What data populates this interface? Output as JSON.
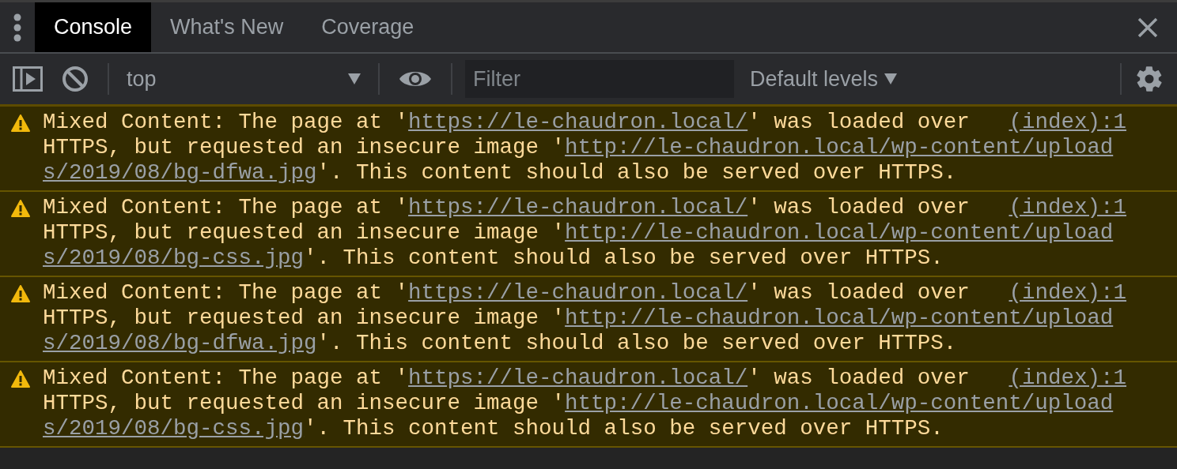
{
  "tabs": [
    {
      "label": "Console",
      "selected": true
    },
    {
      "label": "What's New",
      "selected": false
    },
    {
      "label": "Coverage",
      "selected": false
    }
  ],
  "toolbar": {
    "context": "top",
    "filter": {
      "placeholder": "Filter"
    },
    "levels": "Default levels"
  },
  "messages": [
    {
      "kind": "warning",
      "parts": [
        {
          "kind": "text",
          "text": "Mixed Content: The page at '"
        },
        {
          "kind": "link",
          "text": "https://le-chaudron.local/"
        },
        {
          "kind": "text",
          "text": "' was loaded over "
        },
        {
          "kind": "source",
          "text": "(index):1"
        },
        {
          "kind": "text",
          "text": "HTTPS, but requested an insecure image '"
        },
        {
          "kind": "link",
          "text": "http://le-chaudron.local/wp-content/upload"
        },
        {
          "kind": "link",
          "text": "s/2019/08/bg-dfwa.jpg"
        },
        {
          "kind": "text",
          "text": "'. This content should also be served over HTTPS."
        }
      ]
    },
    {
      "kind": "warning",
      "parts": [
        {
          "kind": "text",
          "text": "Mixed Content: The page at '"
        },
        {
          "kind": "link",
          "text": "https://le-chaudron.local/"
        },
        {
          "kind": "text",
          "text": "' was loaded over "
        },
        {
          "kind": "source",
          "text": "(index):1"
        },
        {
          "kind": "text",
          "text": "HTTPS, but requested an insecure image '"
        },
        {
          "kind": "link",
          "text": "http://le-chaudron.local/wp-content/upload"
        },
        {
          "kind": "link",
          "text": "s/2019/08/bg-css.jpg"
        },
        {
          "kind": "text",
          "text": "'. This content should also be served over HTTPS."
        }
      ]
    },
    {
      "kind": "warning",
      "parts": [
        {
          "kind": "text",
          "text": "Mixed Content: The page at '"
        },
        {
          "kind": "link",
          "text": "https://le-chaudron.local/"
        },
        {
          "kind": "text",
          "text": "' was loaded over "
        },
        {
          "kind": "source",
          "text": "(index):1"
        },
        {
          "kind": "text",
          "text": "HTTPS, but requested an insecure image '"
        },
        {
          "kind": "link",
          "text": "http://le-chaudron.local/wp-content/upload"
        },
        {
          "kind": "link",
          "text": "s/2019/08/bg-dfwa.jpg"
        },
        {
          "kind": "text",
          "text": "'. This content should also be served over HTTPS."
        }
      ]
    },
    {
      "kind": "warning",
      "parts": [
        {
          "kind": "text",
          "text": "Mixed Content: The page at '"
        },
        {
          "kind": "link",
          "text": "https://le-chaudron.local/"
        },
        {
          "kind": "text",
          "text": "' was loaded over "
        },
        {
          "kind": "source",
          "text": "(index):1"
        },
        {
          "kind": "text",
          "text": "HTTPS, but requested an insecure image '"
        },
        {
          "kind": "link",
          "text": "http://le-chaudron.local/wp-content/upload"
        },
        {
          "kind": "link",
          "text": "s/2019/08/bg-css.jpg"
        },
        {
          "kind": "text",
          "text": "'. This content should also be served over HTTPS."
        }
      ]
    }
  ]
}
